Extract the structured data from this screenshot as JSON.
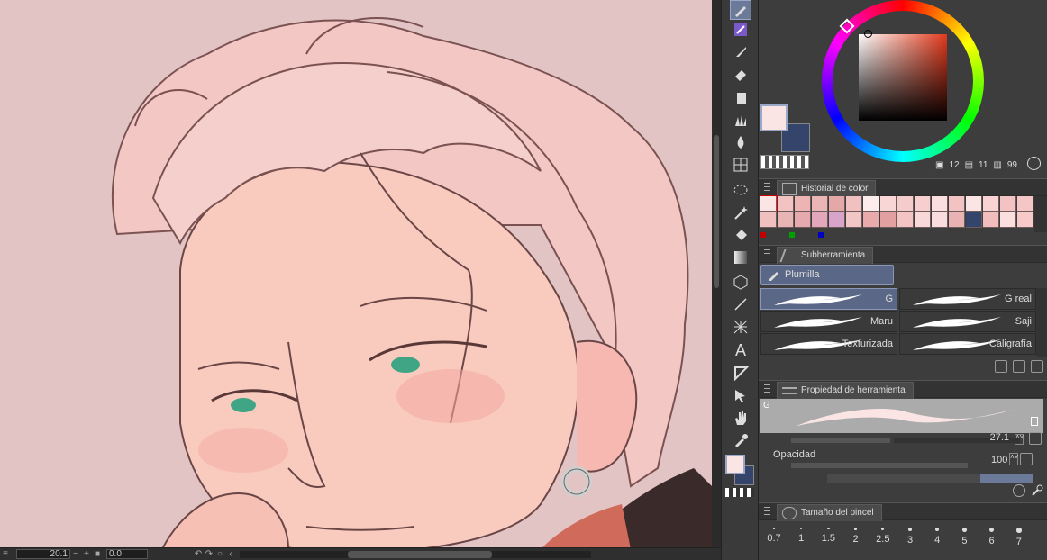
{
  "status_bar": {
    "zoom": "20.1",
    "rotation": "0.0"
  },
  "color_panel": {
    "value_a": "12",
    "value_b": "11",
    "value_c": "99",
    "main_color": "#fbe4e4",
    "sub_color": "#34446a"
  },
  "color_history": {
    "title": "Historial de color",
    "row1": [
      "#fbe4e4",
      "#f3c3c3",
      "#eeb3b3",
      "#e9b5b5",
      "#e4a8a8",
      "#f1c0c0",
      "#fdecec",
      "#f9d6d6",
      "#f5cccc",
      "#f7cfcf",
      "#fbdede",
      "#f3c2c2",
      "#fbe4e4",
      "#f9d3d3",
      "#f3c3c3",
      "#f5c6c6"
    ],
    "row2": [
      "#f0c0c0",
      "#e9b4b4",
      "#e6a9ae",
      "#e2a7bb",
      "#d8a4c9",
      "#f3c6c6",
      "#e8aaaa",
      "#e3a0a0",
      "#f4c4c4",
      "#f9d8d8",
      "#fbdcdc",
      "#e9b3b3",
      "#34446a",
      "#f2bdbd",
      "#fbdede",
      "#f7c9c9"
    ],
    "marks": [
      "#c00000",
      "#00a000",
      "#0000c0"
    ]
  },
  "subtool": {
    "title": "Subherramienta",
    "group": "Plumilla",
    "brushes": [
      "G",
      "G real",
      "Maru",
      "Saji",
      "Texturizada",
      "Caligrafía"
    ]
  },
  "tool_property": {
    "title": "Propiedad de herramienta",
    "preview_label": "G",
    "size_value": "27.1",
    "opacity_label": "Opacidad",
    "opacity_value": "100"
  },
  "brush_size": {
    "title": "Tamaño del pincel",
    "sizes": [
      "0.7",
      "1",
      "1.5",
      "2",
      "2.5",
      "3",
      "4",
      "5",
      "6",
      "7"
    ]
  }
}
